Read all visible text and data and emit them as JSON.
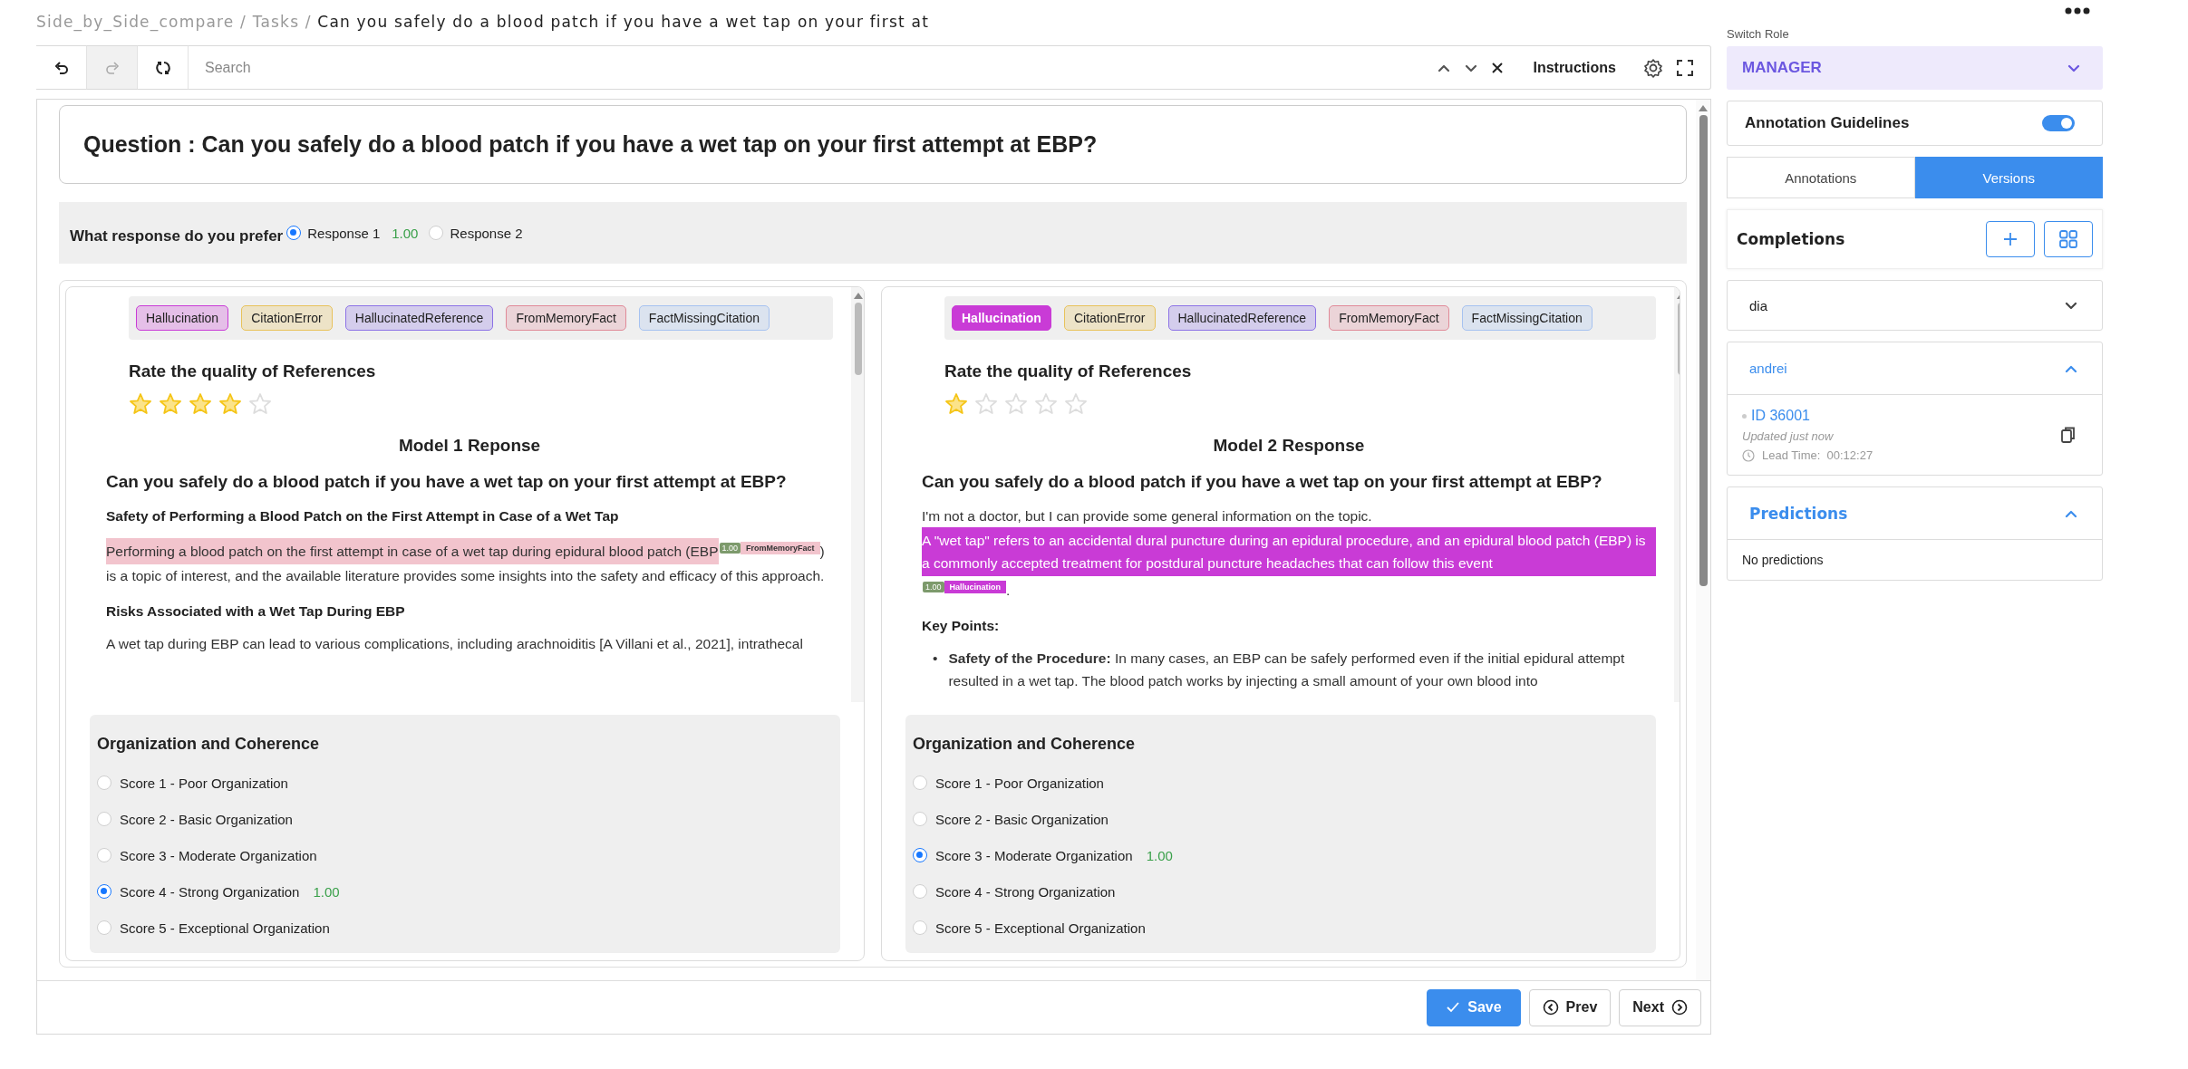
{
  "breadcrumb": {
    "items": [
      "Side_by_Side_compare",
      "Tasks"
    ],
    "separator": "/",
    "current": "Can you safely do a blood patch if you have a wet tap on your first at"
  },
  "toolbar": {
    "buttons": [
      {
        "kind": "undo",
        "disabled": false
      },
      {
        "kind": "redo",
        "disabled": true
      },
      {
        "kind": "reset",
        "disabled": false
      }
    ],
    "search": {
      "placeholder": "Search"
    },
    "instructions": "Instructions"
  },
  "question": "Question : Can you safely do a blood patch if you have a wet tap on your first attempt at EBP?",
  "preference": {
    "label": "What response do you prefer",
    "options": [
      {
        "label": "Response 1",
        "score": "1.00",
        "selected": true
      },
      {
        "label": "Response 2",
        "selected": false
      }
    ]
  },
  "responses": [
    {
      "labels": [
        {
          "text": "Hallucination",
          "color": "#c93bd6",
          "selected": false
        },
        {
          "text": "CitationError",
          "color": "#e8c25a",
          "selected": false
        },
        {
          "text": "HallucinatedReference",
          "color": "#8c72e6",
          "selected": false
        },
        {
          "text": "FromMemoryFact",
          "color": "#e08a98",
          "selected": false
        },
        {
          "text": "FactMissingCitation",
          "color": "#a6c2f0",
          "selected": false
        }
      ],
      "rating_title": "Rate the quality of References",
      "stars": 4,
      "title": "Model 1 Reponse",
      "content": [
        {
          "kind": "heading",
          "text": "Can you safely do a blood patch if you have a wet tap on your first attempt at EBP?"
        },
        {
          "kind": "subheading",
          "text": "Safety of Performing a Blood Patch on the First Attempt in Case of a Wet Tap"
        },
        {
          "kind": "paragraph",
          "segments": [
            {
              "text": "Performing a blood patch on the first attempt in case of a wet tap during epidural blood patch (EBP",
              "highlight": {
                "color": "#f2c4cd",
                "score": "1.00",
                "label": "FromMemoryFact"
              }
            },
            {
              "text": ") is a topic of interest, and the available literature provides some insights into the safety and efficacy of this approach."
            }
          ]
        },
        {
          "kind": "subheading",
          "text": "Risks Associated with a Wet Tap During EBP"
        },
        {
          "kind": "paragraph",
          "segments": [
            {
              "text": "A wet tap during EBP can lead to various complications, including arachnoiditis [A Villani et al., 2021], intrathecal"
            }
          ]
        }
      ],
      "criterion": {
        "title": "Organization and Coherence",
        "options": [
          {
            "label": "Score 1 - Poor Organization",
            "selected": false
          },
          {
            "label": "Score 2 - Basic Organization",
            "selected": false
          },
          {
            "label": "Score 3 - Moderate Organization",
            "selected": false
          },
          {
            "label": "Score 4 - Strong Organization",
            "score": "1.00",
            "selected": true
          },
          {
            "label": "Score 5 - Exceptional Organization",
            "selected": false
          }
        ]
      }
    },
    {
      "labels": [
        {
          "text": "Hallucination",
          "color": "#c93bd6",
          "selected": true
        },
        {
          "text": "CitationError",
          "color": "#e8c25a",
          "selected": false
        },
        {
          "text": "HallucinatedReference",
          "color": "#8c72e6",
          "selected": false
        },
        {
          "text": "FromMemoryFact",
          "color": "#e08a98",
          "selected": false
        },
        {
          "text": "FactMissingCitation",
          "color": "#a6c2f0",
          "selected": false
        }
      ],
      "rating_title": "Rate the quality of References",
      "stars": 1,
      "title": "Model 2 Response",
      "content": [
        {
          "kind": "heading",
          "text": "Can you safely do a blood patch if you have a wet tap on your first attempt at EBP?"
        },
        {
          "kind": "paragraph",
          "segments": [
            {
              "text": "I'm not a doctor, but I can provide some general information on the topic. "
            },
            {
              "text": "A \"wet tap\" refers to an accidental dural puncture during an epidural procedure, and an epidural blood patch (EBP) is a commonly accepted treatment for postdural puncture headaches that can follow this event",
              "highlight": {
                "color": "#c93bd6",
                "score": "1.00",
                "label": "Hallucination"
              }
            },
            {
              "text": "."
            }
          ]
        },
        {
          "kind": "subheading",
          "text": "Key Points:"
        },
        {
          "kind": "bullets",
          "marker": "•",
          "items": [
            "**Safety of the Procedure:** In many cases, an EBP can be safely performed even if the initial epidural attempt resulted in a wet tap. The blood patch works by injecting a small amount of your own blood into"
          ]
        }
      ],
      "criterion": {
        "title": "Organization and Coherence",
        "options": [
          {
            "label": "Score 1 - Poor Organization",
            "selected": false
          },
          {
            "label": "Score 2 - Basic Organization",
            "selected": false
          },
          {
            "label": "Score 3 - Moderate Organization",
            "score": "1.00",
            "selected": true
          },
          {
            "label": "Score 4 - Strong Organization",
            "selected": false
          },
          {
            "label": "Score 5 - Exceptional Organization",
            "selected": false
          }
        ]
      }
    }
  ],
  "footer": {
    "buttons": [
      {
        "kind": "save",
        "label": "Save"
      },
      {
        "kind": "prev",
        "label": "Prev"
      },
      {
        "kind": "next",
        "label": "Next"
      }
    ]
  },
  "sidebar": {
    "switch_role": {
      "label": "Switch Role",
      "value": "MANAGER"
    },
    "guidelines": {
      "label": "Annotation Guidelines",
      "on": true
    },
    "tabs": [
      {
        "label": "Annotations",
        "selected": false
      },
      {
        "label": "Versions",
        "selected": true
      }
    ],
    "completions": {
      "title": "Completions",
      "items": [
        {
          "name": "dia",
          "expanded": false
        },
        {
          "name": "andrei",
          "expanded": true,
          "entry": {
            "id": "ID 36001",
            "updated": "Updated just now",
            "lead_time": "Lead Time:  00:12:27"
          }
        }
      ]
    },
    "predictions": {
      "title": "Predictions",
      "expanded": true,
      "empty_text": "No predictions"
    }
  }
}
